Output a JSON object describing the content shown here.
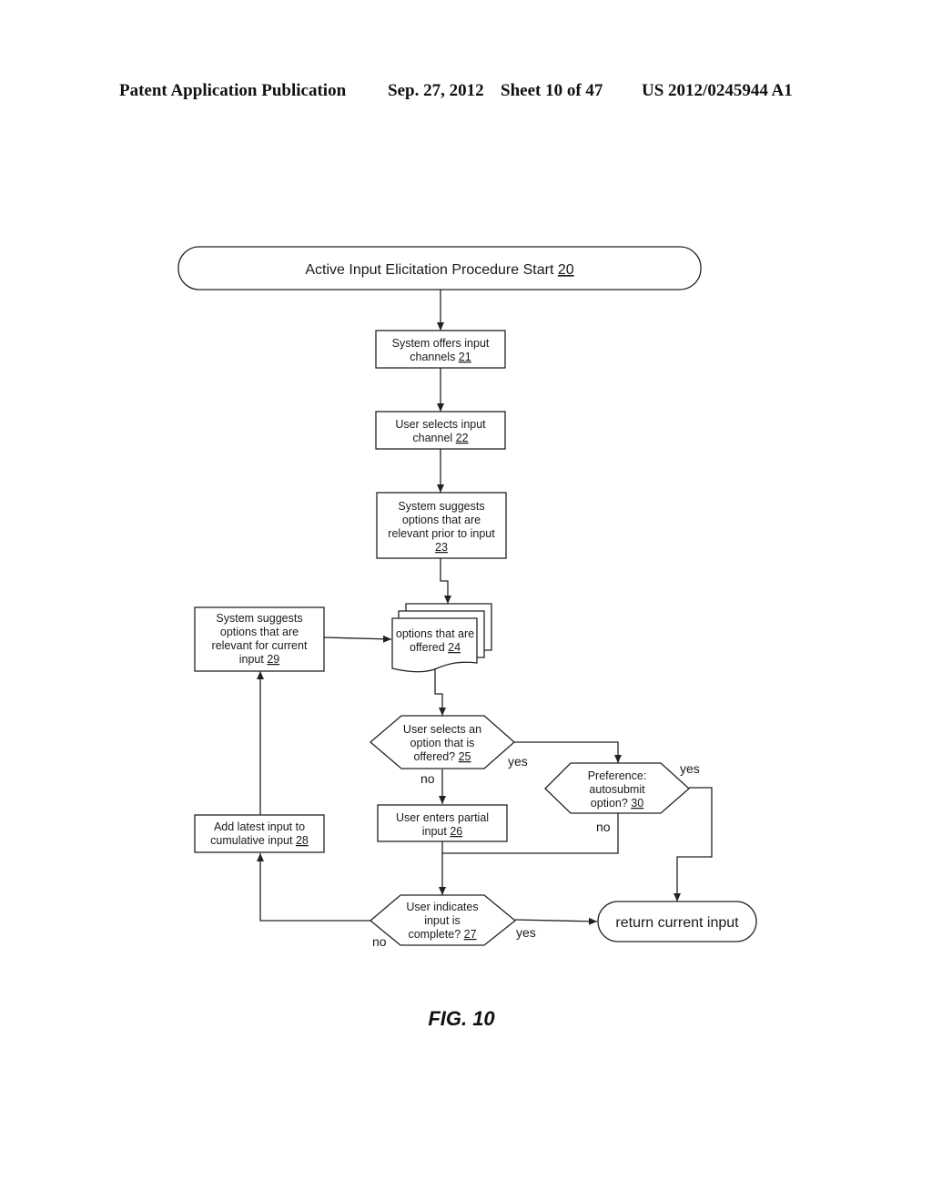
{
  "header": {
    "publication": "Patent Application Publication",
    "date": "Sep. 27, 2012",
    "sheet": "Sheet 10 of 47",
    "number": "US 2012/0245944 A1"
  },
  "flowchart": {
    "start": {
      "text": "Active Input Elicitation Procedure Start ",
      "ref": "20"
    },
    "nodes": {
      "n21": {
        "lines": [
          "System offers input",
          "channels "
        ],
        "ref": "21"
      },
      "n22": {
        "lines": [
          "User selects input",
          "channel "
        ],
        "ref": "22"
      },
      "n23": {
        "lines": [
          "System suggests",
          "options that are",
          "relevant prior to input",
          ""
        ],
        "ref": "23"
      },
      "n24": {
        "lines": [
          "options that are",
          "offered "
        ],
        "ref": "24"
      },
      "n25": {
        "lines": [
          "User selects an",
          "option that is",
          "offered? "
        ],
        "ref": "25"
      },
      "n26": {
        "lines": [
          "User enters partial",
          "input "
        ],
        "ref": "26"
      },
      "n27": {
        "lines": [
          "User indicates",
          "input is",
          "complete? "
        ],
        "ref": "27"
      },
      "n28": {
        "lines": [
          "Add latest input to",
          "cumulative input "
        ],
        "ref": "28"
      },
      "n29": {
        "lines": [
          "System suggests",
          "options that are",
          "relevant for current",
          "input "
        ],
        "ref": "29"
      },
      "n30": {
        "lines": [
          "Preference:",
          "autosubmit",
          "option? "
        ],
        "ref": "30"
      },
      "end": {
        "text": "return current input"
      }
    },
    "edge_labels": {
      "n25_yes": "yes",
      "n25_no": "no",
      "n30_yes": "yes",
      "n30_no": "no",
      "n27_yes": "yes",
      "n27_no": "no"
    }
  },
  "figure_caption": "FIG. 10"
}
